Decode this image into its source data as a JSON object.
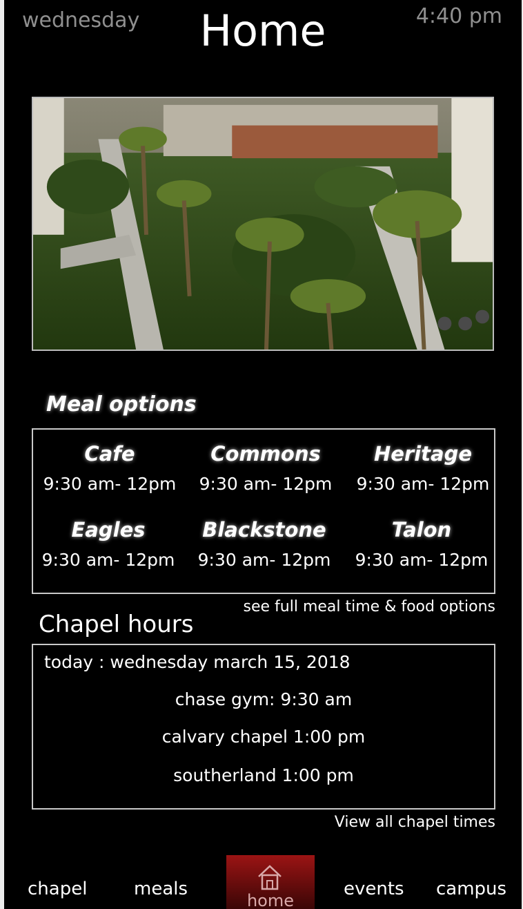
{
  "header": {
    "day": "wednesday",
    "time": "4:40 pm",
    "title": "Home"
  },
  "hero_image": {
    "alt": "campus courtyard with palm trees"
  },
  "meals": {
    "heading": "Meal options",
    "items": [
      {
        "name": "Cafe",
        "hours": "9:30 am- 12pm"
      },
      {
        "name": "Commons",
        "hours": "9:30 am- 12pm"
      },
      {
        "name": "Heritage",
        "hours": "9:30 am- 12pm"
      },
      {
        "name": "Eagles",
        "hours": "9:30 am- 12pm"
      },
      {
        "name": "Blackstone",
        "hours": "9:30 am- 12pm"
      },
      {
        "name": "Talon",
        "hours": "9:30 am- 12pm"
      }
    ],
    "link": "see full meal time & food options"
  },
  "chapel": {
    "heading": "Chapel hours",
    "today": "today : wednesday march 15, 2018",
    "entries": [
      "chase gym: 9:30 am",
      "calvary chapel 1:00 pm",
      "southerland 1:00 pm"
    ],
    "link": "View all chapel times"
  },
  "tabs": {
    "chapel": "chapel",
    "meals": "meals",
    "home": "home",
    "events": "events",
    "campus": "campus",
    "active": "home",
    "active_color": "#9b1414"
  }
}
